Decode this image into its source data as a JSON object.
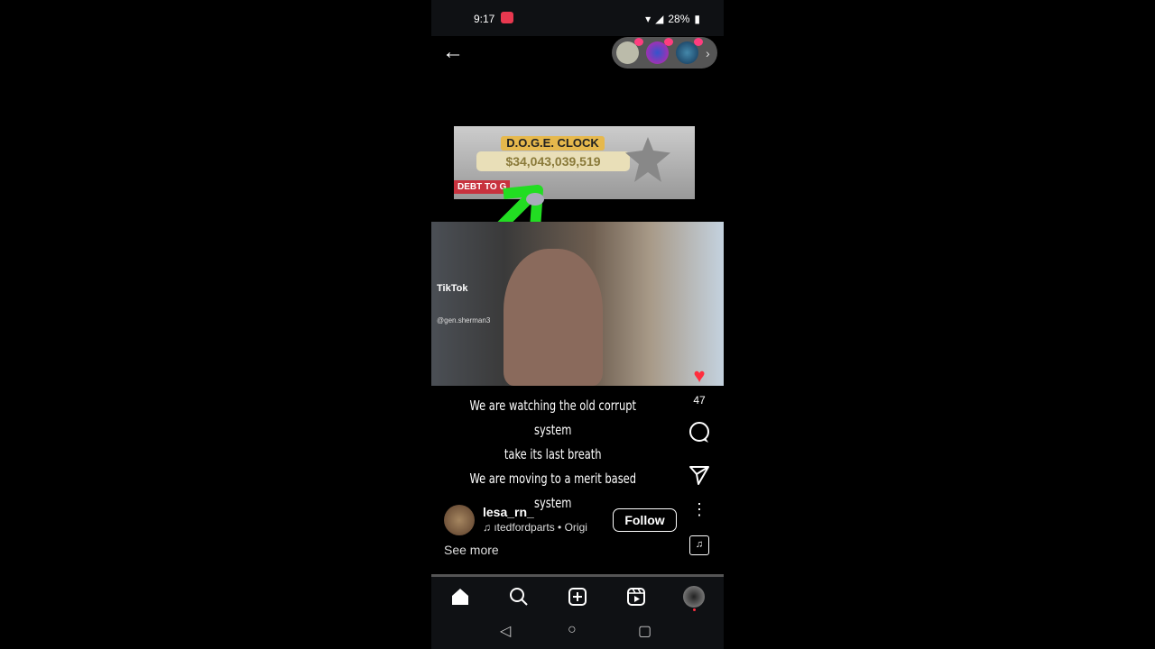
{
  "status": {
    "time": "9:17",
    "battery": "28%"
  },
  "header": {
    "back_icon": "arrow-left-icon",
    "reactors_more": "›"
  },
  "video": {
    "clock_label": "D.O.G.E. CLOCK",
    "clock_amount": "$34,043,039,519",
    "debt_label": "DEBT TO G",
    "watermark": "TikTok",
    "watermark_handle": "@gen.sherman3"
  },
  "caption": [
    "We are watching the old corrupt system",
    "take its last breath",
    "We are moving to a merit based system"
  ],
  "actions": {
    "likes": "47"
  },
  "post": {
    "username": "lesa_rn_",
    "audio": "ıtedfordparts • Origi",
    "follow_label": "Follow",
    "see_more": "See more"
  },
  "colors": {
    "like": "#ff2d3d",
    "record": "#e8384f"
  }
}
